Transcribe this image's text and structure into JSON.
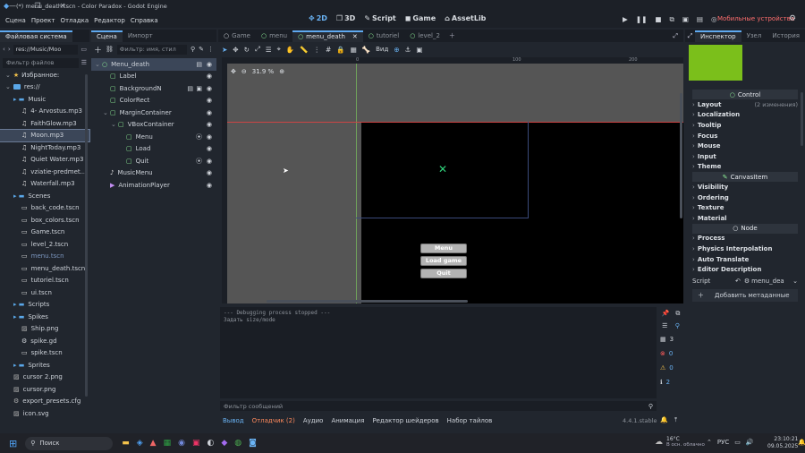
{
  "window": {
    "title": "(*) menu_death.tscn - Color Paradox - Godot Engine",
    "controls": [
      "—",
      "❐",
      "✕"
    ]
  },
  "menubar": {
    "items": [
      "Сцена",
      "Проект",
      "Отладка",
      "Редактор",
      "Справка"
    ],
    "workspaces": [
      "2D",
      "3D",
      "Script",
      "Game",
      "AssetLib"
    ],
    "active_workspace": "2D",
    "device": "Мобильные устройства"
  },
  "filesystem": {
    "tab": "Файловая система",
    "path": "res://Music/Moo",
    "filter_placeholder": "Фильтр файлов",
    "favorites": "Избранное:",
    "root": "res://",
    "tree": [
      {
        "label": "Music",
        "type": "folder",
        "depth": 1
      },
      {
        "label": "4- Arvostus.mp3",
        "type": "audio",
        "depth": 2
      },
      {
        "label": "FaithGlow.mp3",
        "type": "audio",
        "depth": 2
      },
      {
        "label": "Moon.mp3",
        "type": "audio",
        "depth": 2,
        "selected": true
      },
      {
        "label": "NightToday.mp3",
        "type": "audio",
        "depth": 2
      },
      {
        "label": "Quiet Water.mp3",
        "type": "audio",
        "depth": 2
      },
      {
        "label": "vziatie-predmet...",
        "type": "audio",
        "depth": 2
      },
      {
        "label": "Waterfall.mp3",
        "type": "audio",
        "depth": 2
      },
      {
        "label": "Scenes",
        "type": "folder",
        "depth": 1
      },
      {
        "label": "back_code.tscn",
        "type": "scene",
        "depth": 2
      },
      {
        "label": "box_colors.tscn",
        "type": "scene",
        "depth": 2
      },
      {
        "label": "Game.tscn",
        "type": "scene",
        "depth": 2
      },
      {
        "label": "level_2.tscn",
        "type": "scene",
        "depth": 2
      },
      {
        "label": "menu.tscn",
        "type": "scene",
        "depth": 2,
        "dim": true
      },
      {
        "label": "menu_death.tscn",
        "type": "scene",
        "depth": 2
      },
      {
        "label": "tutoriel.tscn",
        "type": "scene",
        "depth": 2
      },
      {
        "label": "ui.tscn",
        "type": "scene",
        "depth": 2
      },
      {
        "label": "Scripts",
        "type": "folder",
        "depth": 1
      },
      {
        "label": "Spikes",
        "type": "folder",
        "depth": 1
      },
      {
        "label": "Ship.png",
        "type": "image",
        "depth": 2
      },
      {
        "label": "spike.gd",
        "type": "script",
        "depth": 2
      },
      {
        "label": "spike.tscn",
        "type": "scene",
        "depth": 2
      },
      {
        "label": "Sprites",
        "type": "folder",
        "depth": 1
      },
      {
        "label": "cursor 2.png",
        "type": "image",
        "depth": 1
      },
      {
        "label": "cursor.png",
        "type": "image",
        "depth": 1
      },
      {
        "label": "export_presets.cfg",
        "type": "cfg",
        "depth": 1
      },
      {
        "label": "icon.svg",
        "type": "image",
        "depth": 1
      }
    ]
  },
  "scene": {
    "tabs": [
      "Сцена",
      "Импорт"
    ],
    "filter_placeholder": "Фильтр: имя, стил",
    "nodes": [
      {
        "label": "Menu_death",
        "color": "#8eef97",
        "depth": 0,
        "selected": true,
        "script": true
      },
      {
        "label": "Label",
        "color": "#8eef97",
        "depth": 1
      },
      {
        "label": "BackgroundN",
        "color": "#8eef97",
        "depth": 1,
        "extra": true
      },
      {
        "label": "ColorRect",
        "color": "#8eef97",
        "depth": 1
      },
      {
        "label": "MarginContainer",
        "color": "#8eef97",
        "depth": 1
      },
      {
        "label": "VBoxContainer",
        "color": "#8eef97",
        "depth": 2
      },
      {
        "label": "Menu",
        "color": "#8eef97",
        "depth": 3,
        "signal": true
      },
      {
        "label": "Load",
        "color": "#8eef97",
        "depth": 3
      },
      {
        "label": "Quit",
        "color": "#8eef97",
        "depth": 3,
        "signal": true
      },
      {
        "label": "MusicMenu",
        "color": "#e0e0e0",
        "depth": 1
      },
      {
        "label": "AnimationPlayer",
        "color": "#c38ef1",
        "depth": 1
      }
    ]
  },
  "editor": {
    "tabs": [
      "Game",
      "menu",
      "menu_death",
      "tutoriel",
      "level_2"
    ],
    "active_tab": "menu_death",
    "view_label": "Вид",
    "zoom": "31.9 %",
    "ruler": [
      "0",
      "100",
      "200"
    ],
    "buttons": [
      "Menu",
      "Load game",
      "Quit"
    ]
  },
  "output": {
    "log": [
      "--- Debugging process stopped ---",
      "Задать size/mode"
    ],
    "filter_placeholder": "Фильтр сообщений",
    "bottom_tabs": [
      "Вывод",
      "Отладчик (2)",
      "Аудио",
      "Анимация",
      "Редактор шейдеров",
      "Набор тайлов"
    ],
    "version": "4.4.1.stable",
    "counts": {
      "all": "3",
      "errors": "0",
      "warnings": "0",
      "info": "2"
    }
  },
  "inspector": {
    "tabs": [
      "Инспектор",
      "Узел",
      "История"
    ],
    "class_header": "Control",
    "sections_control": [
      "Layout",
      "Localization",
      "Tooltip",
      "Focus",
      "Mouse",
      "Input",
      "Theme"
    ],
    "layout_note": "(2 изменения)",
    "canvas_header": "CanvasItem",
    "sections_canvas": [
      "Visibility",
      "Ordering",
      "Texture",
      "Material"
    ],
    "node_header": "Node",
    "sections_node": [
      "Process",
      "Physics Interpolation",
      "Auto Translate",
      "Editor Description"
    ],
    "script_label": "Script",
    "script_value": "menu_dea",
    "add_meta": "Добавить метаданные",
    "preview_color": "#7bbf1b"
  },
  "taskbar": {
    "search": "Поиск",
    "weather_temp": "16°C",
    "weather_desc": "В осн. облачно",
    "lang": "РУС",
    "time": "23:10:21",
    "date": "09.05.2025"
  }
}
